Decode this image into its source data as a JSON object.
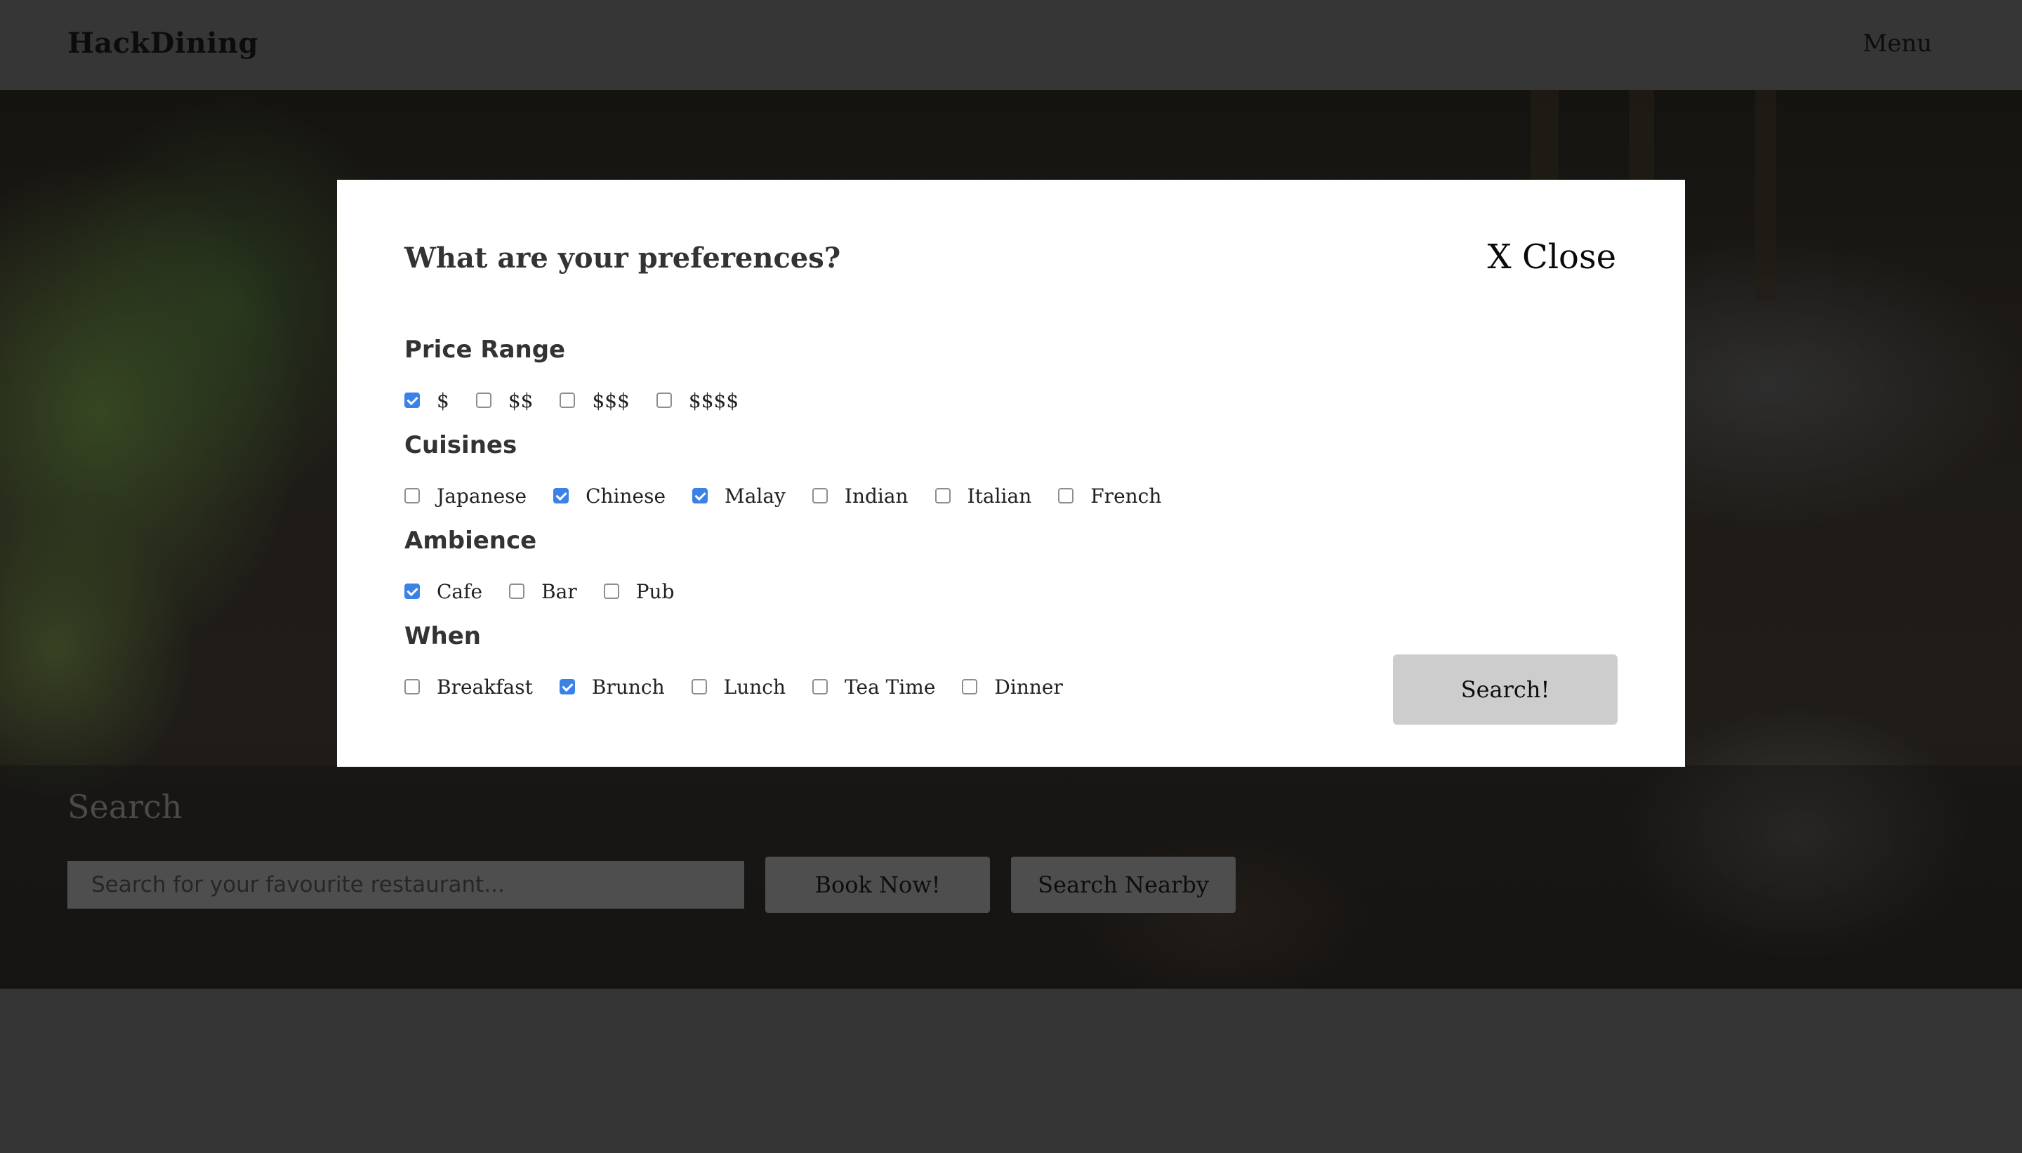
{
  "navbar": {
    "brand": "HackDining",
    "menu_label": "Menu"
  },
  "hero": {
    "search_title": "Search",
    "search_placeholder": "Search for your favourite restaurant...",
    "book_label": "Book Now!",
    "nearby_label": "Search Nearby"
  },
  "modal": {
    "title": "What are your preferences?",
    "close_label": "X Close",
    "submit_label": "Search!",
    "sections": {
      "price": {
        "title": "Price Range",
        "options": [
          {
            "label": "$",
            "checked": true
          },
          {
            "label": "$$",
            "checked": false
          },
          {
            "label": "$$$",
            "checked": false
          },
          {
            "label": "$$$$",
            "checked": false
          }
        ]
      },
      "cuisines": {
        "title": "Cuisines",
        "options": [
          {
            "label": "Japanese",
            "checked": false
          },
          {
            "label": "Chinese",
            "checked": true
          },
          {
            "label": "Malay",
            "checked": true
          },
          {
            "label": "Indian",
            "checked": false
          },
          {
            "label": "Italian",
            "checked": false
          },
          {
            "label": "French",
            "checked": false
          }
        ]
      },
      "ambience": {
        "title": "Ambience",
        "options": [
          {
            "label": "Cafe",
            "checked": true
          },
          {
            "label": "Bar",
            "checked": false
          },
          {
            "label": "Pub",
            "checked": false
          }
        ]
      },
      "when": {
        "title": "When",
        "options": [
          {
            "label": "Breakfast",
            "checked": false
          },
          {
            "label": "Brunch",
            "checked": true
          },
          {
            "label": "Lunch",
            "checked": false
          },
          {
            "label": "Tea Time",
            "checked": false
          },
          {
            "label": "Dinner",
            "checked": false
          }
        ]
      }
    }
  },
  "colors": {
    "page_background": "#353535",
    "modal_background": "#ffffff",
    "checkbox_checked": "#3b82e6",
    "submit_button": "#cdcdcd"
  }
}
